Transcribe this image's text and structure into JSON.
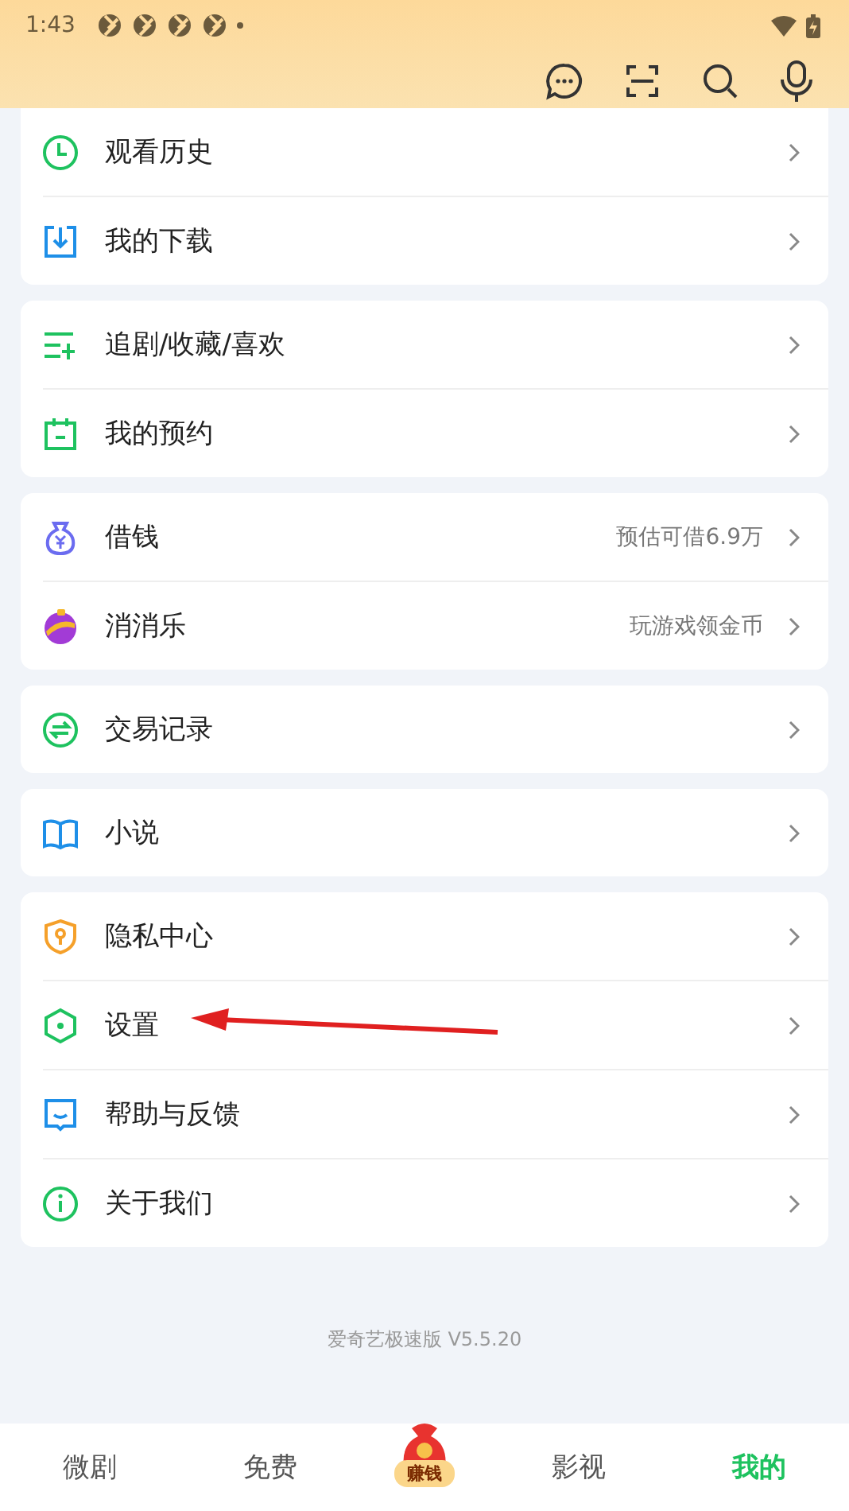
{
  "status_bar": {
    "time": "1:43"
  },
  "groups": [
    {
      "items": [
        {
          "kind": "clock",
          "label": "观看历史"
        },
        {
          "kind": "download",
          "label": "我的下载"
        }
      ]
    },
    {
      "items": [
        {
          "kind": "list-add",
          "label": "追剧/收藏/喜欢"
        },
        {
          "kind": "calendar",
          "label": "我的预约"
        }
      ]
    },
    {
      "items": [
        {
          "kind": "money-bag",
          "label": "借钱",
          "hint": "预估可借6.9万"
        },
        {
          "kind": "ball",
          "label": "消消乐",
          "hint": "玩游戏领金币"
        }
      ]
    },
    {
      "items": [
        {
          "kind": "exchange",
          "label": "交易记录"
        }
      ]
    },
    {
      "items": [
        {
          "kind": "book",
          "label": "小说"
        }
      ]
    },
    {
      "items": [
        {
          "kind": "shield",
          "label": "隐私中心"
        },
        {
          "kind": "hexagon",
          "label": "设置",
          "annotated": true
        },
        {
          "kind": "chat",
          "label": "帮助与反馈"
        },
        {
          "kind": "info",
          "label": "关于我们"
        }
      ]
    }
  ],
  "version": "爱奇艺极速版 V5.5.20",
  "tabs": [
    {
      "label": "微剧",
      "selected": false
    },
    {
      "label": "免费",
      "selected": false
    },
    {
      "label": "赚钱",
      "kind": "promo",
      "selected": false
    },
    {
      "label": "影视",
      "selected": false
    },
    {
      "label": "我的",
      "selected": true
    }
  ]
}
